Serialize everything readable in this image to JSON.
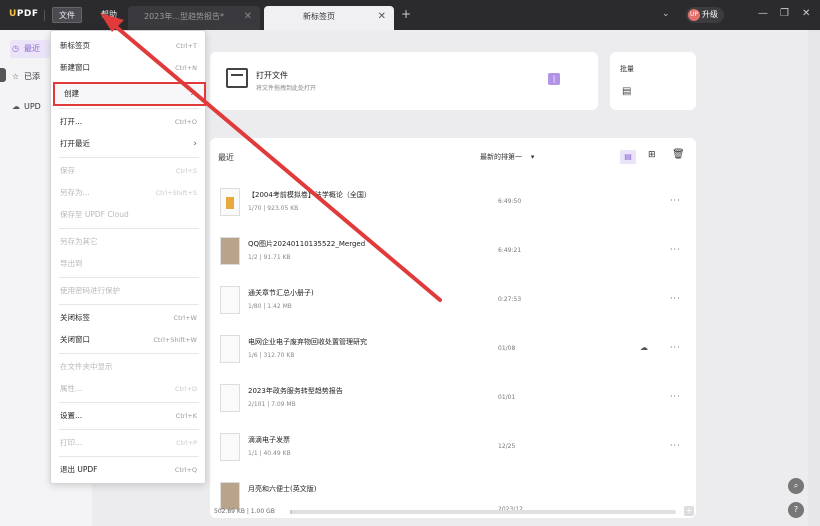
{
  "titlebar": {
    "logo_u": "U",
    "logo_rest": "PDF",
    "menu_file": "文件",
    "menu_help": "帮助",
    "tabs": [
      {
        "label": "2023年...型趋势报告*",
        "close": "✕"
      },
      {
        "label": "新标签页",
        "close": "✕"
      }
    ],
    "add_tab": "+",
    "chevron": "⌄",
    "upgrade_label": "升级",
    "avatar_text": "UP",
    "minimize": "—",
    "restore": "❐",
    "close": "✕"
  },
  "sidebar": {
    "items": [
      {
        "label": "最近",
        "icon": "clock-icon",
        "glyph": "◷"
      },
      {
        "label": "已添",
        "icon": "star-icon",
        "glyph": "☆"
      },
      {
        "label": "UPD",
        "icon": "cloud-icon",
        "glyph": "☁"
      }
    ]
  },
  "main": {
    "open_file_title": "打开文件",
    "open_file_sub": "将文件拖拽到此处打开",
    "pdf_badge": "|",
    "batch_label": "批量",
    "recent_label": "最近",
    "sort_label": "最新的排第一",
    "sort_arrow": "▾",
    "view_list": "▤",
    "view_grid": "⊞",
    "trash": "🗑",
    "files": [
      {
        "name": "【2004考前模拟卷】法学概论（全国）",
        "meta": "1/70  |  923.05 KB",
        "time": "6:49:50",
        "more": "···"
      },
      {
        "name": "QQ图片20240110135522_Merged",
        "meta": "1/2  |  91.71 KB",
        "time": "6:49:21",
        "more": "···"
      },
      {
        "name": "通关章节汇总小册子)",
        "meta": "1/80  |  1.42 MB",
        "time": "0:27:53",
        "more": "···"
      },
      {
        "name": "电网企业电子废弃物回收处置管理研究",
        "meta": "1/6  |  312.70 KB",
        "time": "01/08",
        "more": "···",
        "cloud": "☁"
      },
      {
        "name": "2023年政务服务转型趋势报告",
        "meta": "2/101  |  7.09 MB",
        "time": "01/01",
        "more": "···"
      },
      {
        "name": "滴滴电子发票",
        "meta": "1/1  |  40.49 KB",
        "time": "12/25",
        "more": "···"
      },
      {
        "name": "月亮和六便士(英文版)",
        "meta": "",
        "time": "2023/12",
        "more": "···"
      }
    ],
    "storage_text": "502.89 KB | 1.00 GB",
    "storage_fraction": 0.0005,
    "storage_plus": "+",
    "float_search": "⌕",
    "float_help": "?"
  },
  "file_menu": {
    "items": [
      {
        "label": "新标签页",
        "shortcut": "Ctrl+T",
        "disabled": false
      },
      {
        "label": "新建窗口",
        "shortcut": "Ctrl+N",
        "disabled": false
      },
      {
        "label": "创建",
        "submenu": "›",
        "disabled": false,
        "highlight": true
      },
      {
        "label": "打开...",
        "shortcut": "Ctrl+O",
        "disabled": false
      },
      {
        "label": "打开最近",
        "submenu": "›",
        "disabled": false
      },
      {
        "label": "保存",
        "shortcut": "Ctrl+S",
        "disabled": true
      },
      {
        "label": "另存为...",
        "shortcut": "Ctrl+Shift+S",
        "disabled": true
      },
      {
        "label": "保存至 UPDF Cloud",
        "disabled": true
      },
      {
        "label": "另存为其它",
        "disabled": true
      },
      {
        "label": "导出到",
        "disabled": true
      },
      {
        "label": "使用密码进行保护",
        "disabled": true
      },
      {
        "label": "关闭标签",
        "shortcut": "Ctrl+W",
        "disabled": false
      },
      {
        "label": "关闭窗口",
        "shortcut": "Ctrl+Shift+W",
        "disabled": false
      },
      {
        "label": "在文件夹中显示",
        "disabled": true
      },
      {
        "label": "属性...",
        "shortcut": "Ctrl+D",
        "disabled": true
      },
      {
        "label": "设置...",
        "shortcut": "Ctrl+K",
        "disabled": false
      },
      {
        "label": "打印...",
        "shortcut": "Ctrl+P",
        "disabled": true
      },
      {
        "label": "退出 UPDF",
        "shortcut": "Ctrl+Q",
        "disabled": false
      }
    ]
  },
  "colors": {
    "accent": "#8a63d2",
    "annotation": "#e03a3a",
    "titlebar": "#2b2b2e"
  }
}
